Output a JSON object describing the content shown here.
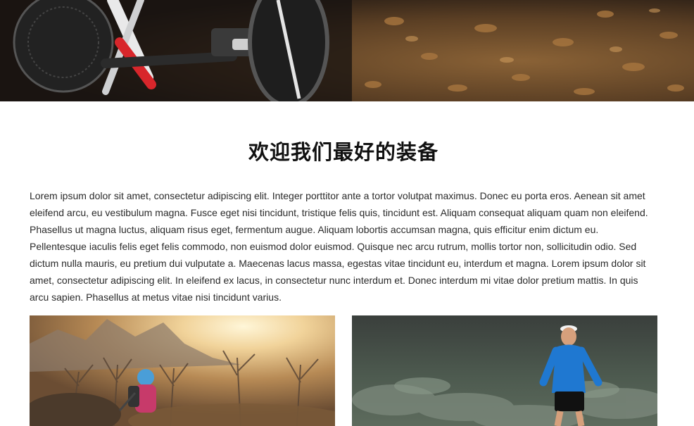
{
  "hero": {
    "icon": "mountain-bike-hero-image"
  },
  "main": {
    "title": "欢迎我们最好的装备",
    "paragraph": "Lorem ipsum dolor sit amet, consectetur adipiscing elit. Integer porttitor ante a tortor volutpat maximus. Donec eu porta eros. Aenean sit amet eleifend arcu, eu vestibulum magna. Fusce eget nisi tincidunt, tristique felis quis, tincidunt est. Aliquam consequat aliquam quam non eleifend. Phasellus ut magna luctus, aliquam risus eget, fermentum augue. Aliquam lobortis accumsan magna, quis efficitur enim dictum eu. Pellentesque iaculis felis eget felis commodo, non euismod dolor euismod. Quisque nec arcu rutrum, mollis tortor non, sollicitudin odio. Sed dictum nulla mauris, eu pretium dui vulputate a. Maecenas lacus massa, egestas vitae tincidunt eu, interdum et magna. Lorem ipsum dolor sit amet, consectetur adipiscing elit. In eleifend ex lacus, in consectetur nunc interdum et. Donec interdum mi vitae dolor pretium mattis. In quis arcu sapien. Phasellus at metus vitae nisi tincidunt varius."
  },
  "gallery": {
    "left_image": "hiker-mountain-sunlight-image",
    "right_image": "trail-runner-image"
  }
}
